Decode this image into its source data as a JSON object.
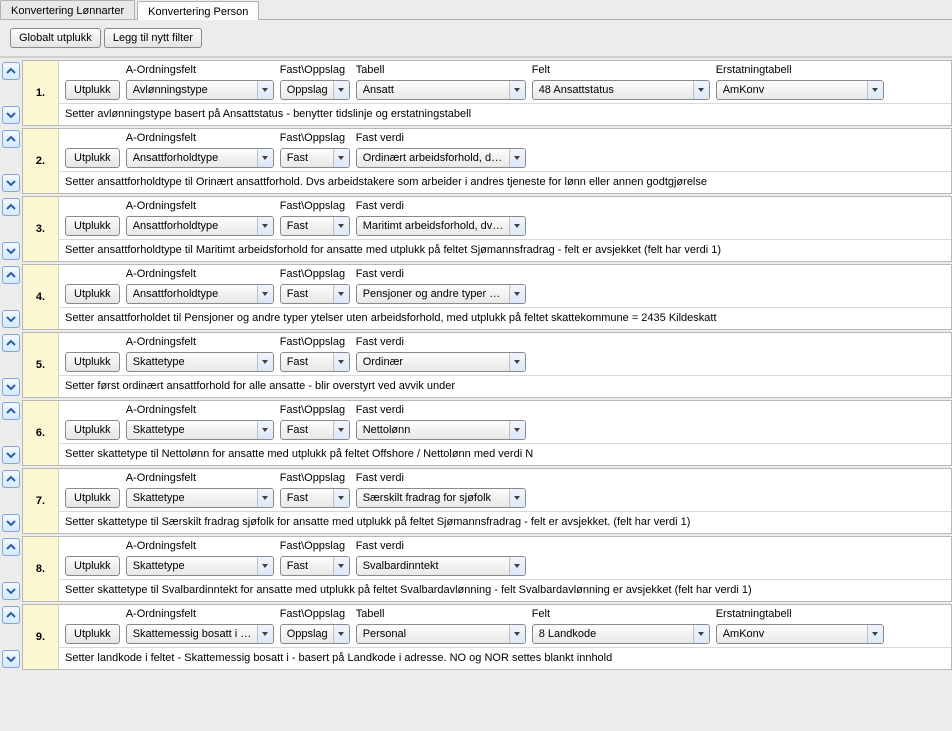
{
  "tabs": {
    "items": [
      {
        "label": "Konvertering Lønnarter"
      },
      {
        "label": "Konvertering Person"
      }
    ],
    "active": 1
  },
  "toolbar": {
    "global_pick": "Globalt utplukk",
    "add_filter": "Legg til nytt filter"
  },
  "headers": {
    "a_ordningsfelt": "A-Ordningsfelt",
    "fast_oppslag": "Fast\\Oppslag",
    "tabell": "Tabell",
    "felt": "Felt",
    "erstatningtabell": "Erstatningtabell",
    "fast_verdi": "Fast verdi",
    "utplukk": "Utplukk"
  },
  "rows": [
    {
      "num": "1.",
      "mode": "oppslag",
      "a_ord": "Avlønningstype",
      "fo": "Oppslag",
      "tabell": "Ansatt",
      "felt": "48 Ansattstatus",
      "ers": "AmKonv",
      "desc": "Setter avlønningstype basert på Ansattstatus - benytter tidslinje og erstatningstabell"
    },
    {
      "num": "2.",
      "mode": "fast",
      "a_ord": "Ansattforholdtype",
      "fo": "Fast",
      "fastverdi": "Ordinært arbeidsforhold, dvs. a",
      "desc": "Setter ansattforholdtype til Orinært ansattforhold. Dvs arbeidstakere som arbeider i andres tjeneste for lønn eller annen godtgjørelse"
    },
    {
      "num": "3.",
      "mode": "fast",
      "a_ord": "Ansattforholdtype",
      "fo": "Fast",
      "fastverdi": "Maritimt arbeidsforhold, dvs. ar",
      "desc": "Setter ansattforholdtype til Maritimt arbeidsforhold for ansatte med utplukk på feltet Sjømannsfradrag - felt er avsjekket (felt har verdi 1)"
    },
    {
      "num": "4.",
      "mode": "fast",
      "a_ord": "Ansattforholdtype",
      "fo": "Fast",
      "fastverdi": "Pensjoner og andre typer ytels",
      "desc": "Setter ansattforholdet til Pensjoner og andre typer ytelser uten arbeidsforhold, med utplukk på feltet skattekommune = 2435 Kildeskatt"
    },
    {
      "num": "5.",
      "mode": "fast",
      "a_ord": "Skattetype",
      "fo": "Fast",
      "fastverdi": "Ordinær",
      "desc": "Setter først ordinært ansattforhold for alle ansatte - blir overstyrt ved avvik under"
    },
    {
      "num": "6.",
      "mode": "fast",
      "a_ord": "Skattetype",
      "fo": "Fast",
      "fastverdi": "Nettolønn",
      "desc": "Setter skattetype til Nettolønn for ansatte med utplukk på feltet Offshore / Nettolønn med verdi N"
    },
    {
      "num": "7.",
      "mode": "fast",
      "a_ord": "Skattetype",
      "fo": "Fast",
      "fastverdi": "Særskilt fradrag for sjøfolk",
      "desc": "Setter skattetype til Særskilt fradrag sjøfolk for ansatte med utplukk på feltet Sjømannsfradrag - felt er avsjekket. (felt har verdi 1)"
    },
    {
      "num": "8.",
      "mode": "fast",
      "a_ord": "Skattetype",
      "fo": "Fast",
      "fastverdi": "Svalbardinntekt",
      "desc": "Setter skattetype til Svalbardinntekt for ansatte med utplukk på feltet Svalbardavlønning - felt Svalbardavlønning er avsjekket (felt har verdi 1)"
    },
    {
      "num": "9.",
      "mode": "oppslag",
      "a_ord": "Skattemessig bosatt i lan",
      "fo": "Oppslag",
      "tabell": "Personal",
      "felt": "8 Landkode",
      "ers": "AmKonv",
      "desc": "Setter landkode i feltet - Skattemessig bosatt i - basert på Landkode i adresse. NO og NOR settes blankt innhold"
    }
  ]
}
